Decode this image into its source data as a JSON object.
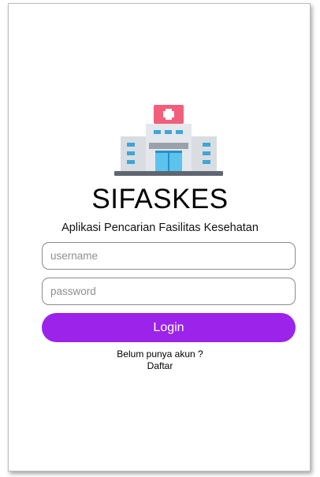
{
  "app": {
    "title": "SIFASKES",
    "subtitle": "Aplikasi Pencarian Fasilitas Kesehatan"
  },
  "form": {
    "username_placeholder": "username",
    "password_placeholder": "password",
    "login_label": "Login",
    "register_prompt": "Belum punya akun ?",
    "register_link": "Daftar"
  },
  "icons": {
    "logo": "hospital-building-icon"
  },
  "colors": {
    "accent": "#9b23ea",
    "logo_roof": "#f25f7a",
    "logo_building": "#dde1e6",
    "logo_windows": "#3ea6d8",
    "logo_base": "#5e6672"
  }
}
